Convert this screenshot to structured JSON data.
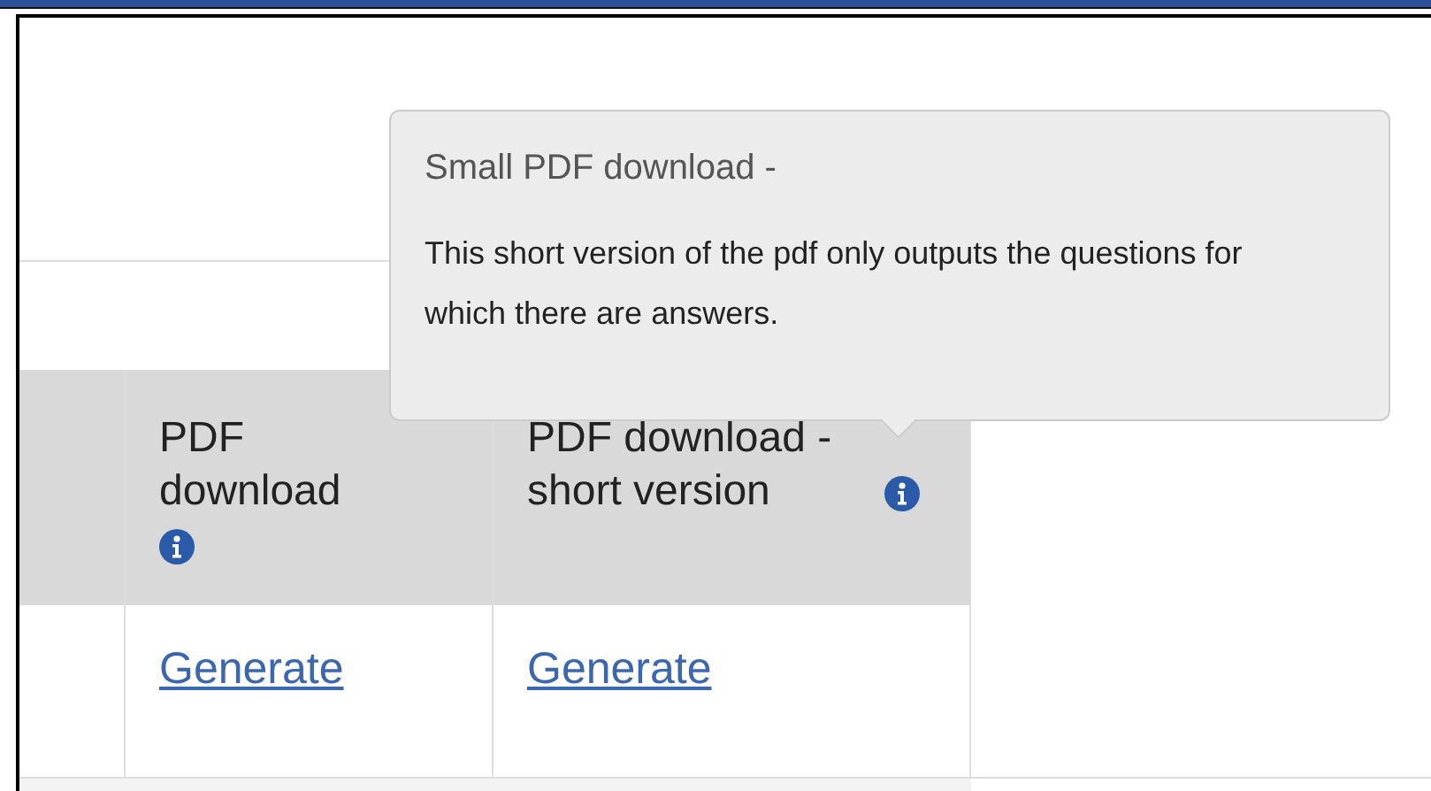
{
  "table": {
    "columns": [
      {
        "label": "PDF download",
        "info": true
      },
      {
        "label": "PDF download - short version",
        "info": true
      }
    ],
    "rows": [
      {
        "cells": [
          "Generate",
          "Generate"
        ]
      }
    ]
  },
  "tooltip": {
    "title": "Small PDF download -",
    "body": "This short version of the pdf only outputs the questions for which there are answers."
  }
}
